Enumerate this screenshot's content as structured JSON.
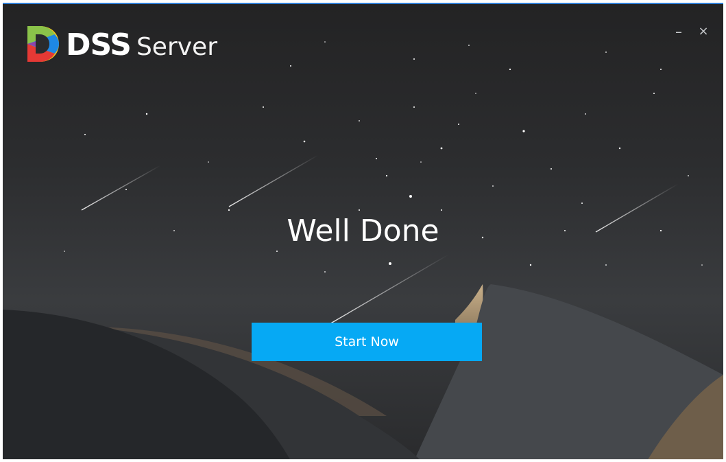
{
  "window": {
    "brand_bold": "DSS",
    "brand_light": "Server",
    "minimize_label": "–",
    "close_label": "×"
  },
  "main": {
    "headline": "Well Done",
    "start_button_label": "Start Now"
  },
  "icons": {
    "logo": "dss-logo-icon",
    "minimize": "minimize-icon",
    "close": "close-icon"
  },
  "colors": {
    "accent": "#06a9f4",
    "titlebar_border": "#2f7fd6",
    "background_dark": "#2a2b2d"
  }
}
